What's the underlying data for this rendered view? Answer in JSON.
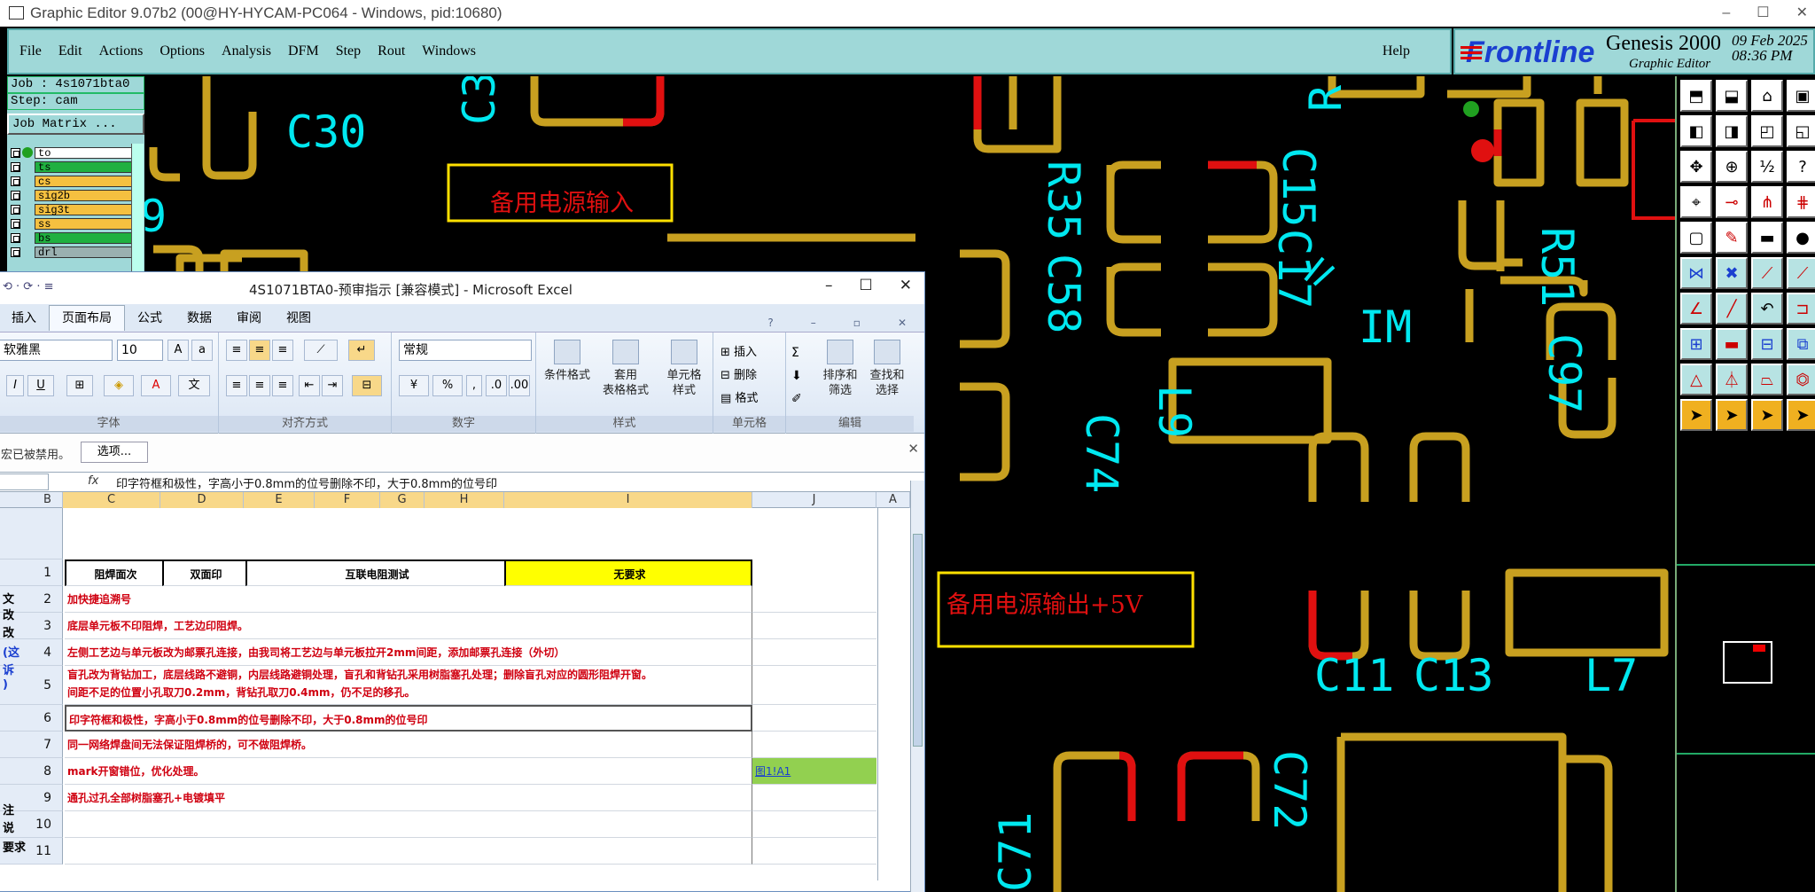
{
  "window_title": "Graphic Editor 9.07b2 (00@HY-HYCAM-PC064 - Windows, pid:10680)",
  "window_buttons": [
    "–",
    "☐",
    "✕"
  ],
  "menu": [
    "File",
    "Edit",
    "Actions",
    "Options",
    "Analysis",
    "DFM",
    "Step",
    "Rout",
    "Windows"
  ],
  "help": "Help",
  "brand": {
    "logo": "Frontline",
    "product": "Genesis 2000",
    "subtitle": "Graphic Editor",
    "date": "09 Feb 2025",
    "time": "08:36 PM"
  },
  "job": {
    "job": "Job : 4s1071bta0",
    "step": "Step: cam",
    "matrix_button": "Job Matrix ..."
  },
  "layers": [
    {
      "name": "to",
      "color": "#ffffff",
      "dot": "#20a020"
    },
    {
      "name": "ts",
      "color": "#20b040",
      "dot": ""
    },
    {
      "name": "cs",
      "color": "#f5c040",
      "dot": ""
    },
    {
      "name": "sig2b",
      "color": "#f5c040",
      "dot": ""
    },
    {
      "name": "sig3t",
      "color": "#f5c040",
      "dot": ""
    },
    {
      "name": "ss",
      "color": "#f5c040",
      "dot": ""
    },
    {
      "name": "bs",
      "color": "#20b040",
      "dot": ""
    },
    {
      "name": "drl",
      "color": "#9ab0b0",
      "dot": ""
    }
  ],
  "pcb_labels": {
    "c30": "C30",
    "c3": "C3",
    "c9": "9",
    "r35": "R35",
    "c58": "C58",
    "c17": "C17",
    "c15": "C15",
    "im": "IM",
    "r51": "R51",
    "c97": "C97",
    "l9": "L9",
    "c74": "C74",
    "c11": "C11",
    "c13": "C13",
    "l7": "L7",
    "c71": "C71",
    "c72": "C72",
    "r_top": "R"
  },
  "annotations": {
    "input": "备用电源输入",
    "output": "备用电源输出+5V"
  },
  "colors": {
    "pad": "#c8a020",
    "pad_red": "#e01010",
    "silk": "#00e8f0",
    "annotation": "#ffe000",
    "annotation_text": "#e01010"
  },
  "excel": {
    "title": "4S1071BTA0-预审指示  [兼容模式] - Microsoft Excel",
    "quick_access": "⟲ · ⟳ · ≡",
    "tabs": [
      "插入",
      "页面布局",
      "公式",
      "数据",
      "审阅",
      "视图"
    ],
    "active_tab": "页面布局",
    "ribbon": {
      "font_name": "软雅黑",
      "font_size": "10",
      "number_format": "常规",
      "groups": [
        "字体",
        "对齐方式",
        "数字",
        "样式",
        "单元格",
        "编辑"
      ],
      "style_buttons": [
        "条件格式",
        "套用\n表格格式",
        "单元格\n样式"
      ],
      "cell_buttons": [
        "插入",
        "删除",
        "格式"
      ],
      "edit_buttons": [
        "排序和\n筛选",
        "查找和\n选择"
      ]
    },
    "macro_message": "宏已被禁用。",
    "options_button": "选项...",
    "formula": "印字符框和极性，字高小于0.8mm的位号删除不印，大于0.8mm的位号印",
    "columns": [
      "B",
      "C",
      "D",
      "E",
      "F",
      "G",
      "H",
      "I",
      "J",
      "A"
    ],
    "header_row": {
      "num": "1",
      "c": "阻焊面次",
      "d": "双面印",
      "e": "互联电阻测试",
      "i": "无要求"
    },
    "rows": [
      {
        "num": "2",
        "text": "加快捷追溯号"
      },
      {
        "num": "3",
        "text": "底层单元板不印阻焊，工艺边印阻焊。"
      },
      {
        "num": "4",
        "text": "左侧工艺边与单元板改为邮票孔连接，由我司将工艺边与单元板拉开2mm间距，添加邮票孔连接（外切）"
      },
      {
        "num": "5",
        "text": "盲孔改为背钻加工，底层线路不避铜，内层线路避铜处理，盲孔和背钻孔采用树脂塞孔处理；删除盲孔对应的圆形阻焊开窗。",
        "text2": "间距不足的位置小孔取刀0.2mm，背钻孔取刀0.4mm，仍不足的移孔。"
      },
      {
        "num": "6",
        "text": "印字符框和极性，字高小于0.8mm的位号删除不印，大于0.8mm的位号印"
      },
      {
        "num": "7",
        "text": "同一网络焊盘间无法保证阻焊桥的，可不做阻焊桥。"
      },
      {
        "num": "8",
        "text": "mark开窗错位，优化处理。",
        "j": "图1!A1"
      },
      {
        "num": "9",
        "text": "通孔过孔全部树脂塞孔+电镀填平"
      },
      {
        "num": "10",
        "text": ""
      },
      {
        "num": "11",
        "text": ""
      }
    ],
    "side_text": [
      "文",
      "改",
      "改",
      "(这",
      "诉",
      ")",
      "注",
      "说",
      "要求"
    ]
  }
}
